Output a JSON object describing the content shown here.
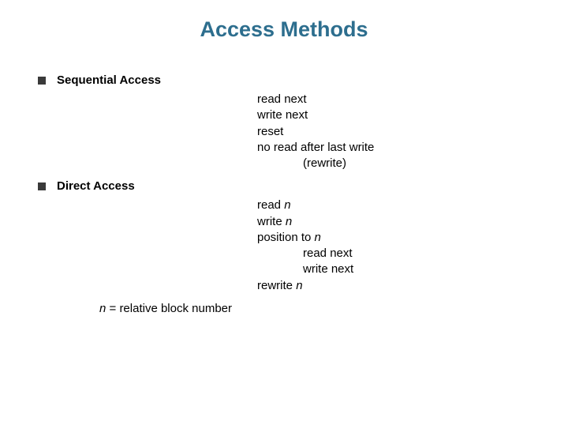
{
  "title": "Access Methods",
  "sections": [
    {
      "label": "Sequential Access",
      "ops": {
        "l1": "read next",
        "l2": "write next",
        "l3": "reset",
        "l4": "no read after last write",
        "l5": "(rewrite)"
      }
    },
    {
      "label": "Direct Access",
      "ops": {
        "l1_pre": "read ",
        "l1_n": "n",
        "l2_pre": "write ",
        "l2_n": "n",
        "l3_pre": "position to ",
        "l3_n": "n",
        "l4": "read next",
        "l5": "write next",
        "l6_pre": "rewrite ",
        "l6_n": "n"
      },
      "note": {
        "n": "n",
        "rest": " = relative block number"
      }
    }
  ]
}
